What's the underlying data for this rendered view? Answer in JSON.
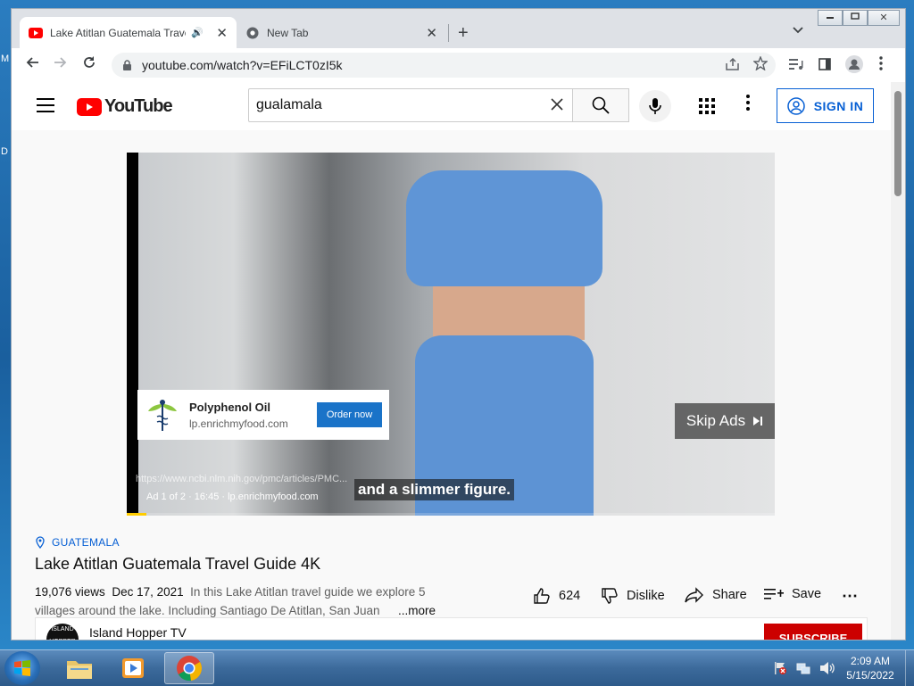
{
  "desktop": {
    "side_labels": [
      "M",
      "D"
    ]
  },
  "browser": {
    "tabs": [
      {
        "title": "Lake Atitlan Guatemala Trave",
        "active": true
      },
      {
        "title": "New Tab",
        "active": false
      }
    ],
    "new_tab_label": "+",
    "close_label": "✕",
    "url": "youtube.com/watch?v=EFiLCT0zI5k",
    "window_controls": {
      "minimize": "▭",
      "maximize": "⧉",
      "close": "✕"
    }
  },
  "youtube": {
    "logo_text": "YouTube",
    "search": {
      "value": "gualamala",
      "placeholder": "Search"
    },
    "sign_in_label": "SIGN IN",
    "ad": {
      "advertiser": "Polyphenol Oil",
      "domain": "lp.enrichmyfood.com",
      "cta": "Order now",
      "skip_label": "Skip Ads",
      "overlay_url": "https://www.ncbi.nlm.nih.gov/pmc/articles/PMC...",
      "caption": "and a slimmer figure.",
      "meta": "Ad 1 of 2 · 16:45 · lp.enrichmyfood.com",
      "progress": 0.03
    },
    "video": {
      "hashtag": "GUATEMALA",
      "title": "Lake Atitlan Guatemala Travel Guide 4K",
      "views": "19,076 views",
      "date": "Dec 17, 2021",
      "description_line1": "In this Lake Atitlan travel guide we explore 5",
      "description_line2": "villages around the lake. Including Santiago De Atitlan, San Juan",
      "more_label": "...more"
    },
    "actions": {
      "likes": "624",
      "dislike": "Dislike",
      "share": "Share",
      "save": "Save",
      "more": "⋯"
    },
    "channel": {
      "name": "Island Hopper TV",
      "avatar_text": "ISLAND HOPPER",
      "subscribe": "SUBSCRIBE"
    }
  },
  "taskbar": {
    "time": "2:09 AM",
    "date": "5/15/2022"
  },
  "colors": {
    "yt_red": "#ff0000",
    "link_blue": "#065fd4",
    "cta_blue": "#1a73c8",
    "taskbar": "#3c6a9b"
  }
}
